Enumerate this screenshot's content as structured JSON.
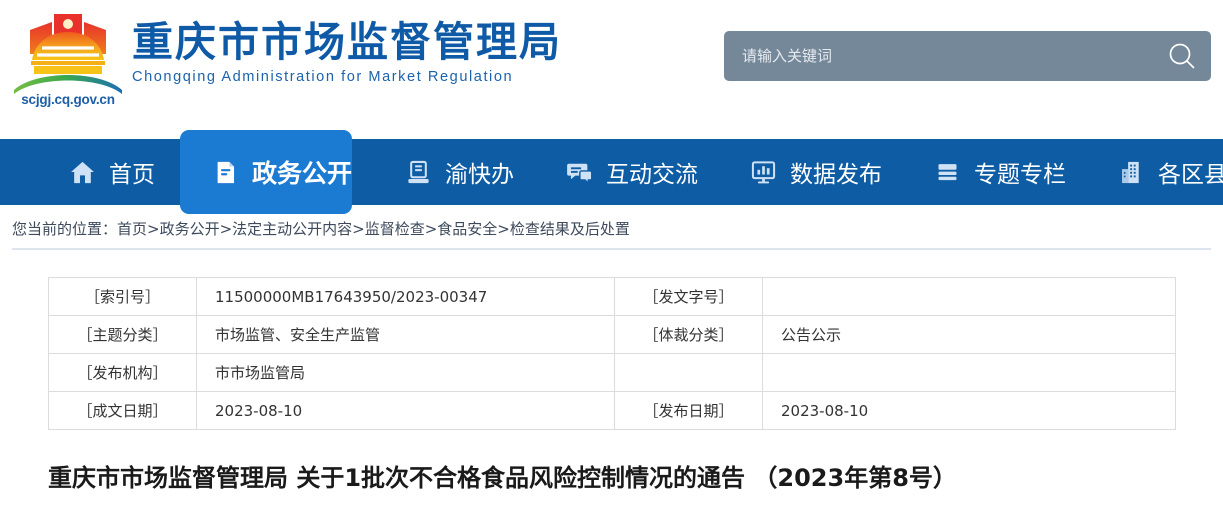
{
  "site": {
    "title_cn": "重庆市市场监督管理局",
    "title_en": "Chongqing  Administration for Market Regulation",
    "domain": "scjgj.cq.gov.cn",
    "logo_icon": "chongqing-great-hall-emblem-icon",
    "brand_color": "#0f5aa6",
    "nav_bg_color": "#0e5ca4",
    "nav_active_color": "#1b7ad2"
  },
  "search": {
    "placeholder": "请输入关键词",
    "value": "",
    "icon": "search-icon",
    "bg_color": "#75889a"
  },
  "nav": {
    "items": [
      {
        "label": "首页",
        "icon": "home-icon",
        "active": false
      },
      {
        "label": "政务公开",
        "icon": "document-icon",
        "active": true
      },
      {
        "label": "渝快办",
        "icon": "service-desk-icon",
        "active": false
      },
      {
        "label": "互动交流",
        "icon": "chat-bubbles-icon",
        "active": false
      },
      {
        "label": "数据发布",
        "icon": "bar-chart-monitor-icon",
        "active": false
      },
      {
        "label": "专题专栏",
        "icon": "stacked-layers-icon",
        "active": false
      },
      {
        "label": "各区县局",
        "icon": "buildings-icon",
        "active": false
      }
    ]
  },
  "breadcrumb": {
    "prefix": "您当前的位置：",
    "path": "首页>政务公开>法定主动公开内容>监督检查>食品安全>检查结果及后处置",
    "full": "您当前的位置：首页>政务公开>法定主动公开内容>监督检查>食品安全>检查结果及后处置"
  },
  "meta_table": {
    "rows": [
      {
        "left_label": "［索引号］",
        "left_value": "11500000MB17643950/2023-00347",
        "right_label": "［发文字号］",
        "right_value": ""
      },
      {
        "left_label": "［主题分类］",
        "left_value": "市场监管、安全生产监管",
        "right_label": "［体裁分类］",
        "right_value": "公告公示"
      },
      {
        "left_label": "［发布机构］",
        "left_value": "市市场监管局",
        "right_label": "",
        "right_value": ""
      },
      {
        "left_label": "［成文日期］",
        "left_value": "2023-08-10",
        "right_label": "［发布日期］",
        "right_value": "2023-08-10"
      }
    ]
  },
  "article": {
    "title": "重庆市市场监督管理局 关于1批次不合格食品风险控制情况的通告 （2023年第8号）"
  }
}
